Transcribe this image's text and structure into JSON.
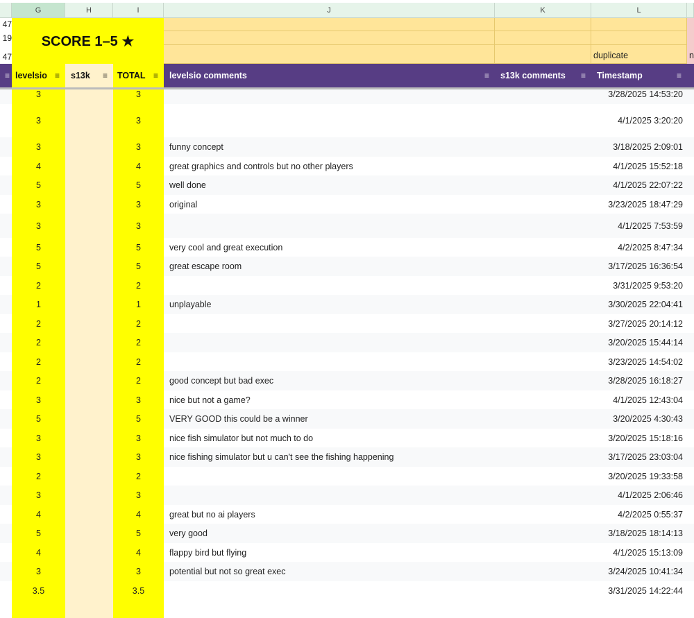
{
  "columns": [
    "G",
    "H",
    "I",
    "J",
    "K",
    "L"
  ],
  "row_numbers_partial": [
    "47",
    "19",
    "47"
  ],
  "banner": "SCORE 1–5 ★",
  "duplicate_label": "duplicate",
  "m_partial": "n",
  "headers": {
    "levelsio": "levelsio",
    "s13k": "s13k",
    "total": "TOTAL",
    "levelsio_comments": "levelsio comments",
    "s13k_comments": "s13k comments",
    "timestamp": "Timestamp"
  },
  "rows": [
    {
      "levelsio": "3",
      "total": "3",
      "comment": "",
      "timestamp": "3/28/2025 14:53:20"
    },
    {
      "levelsio": "3",
      "total": "3",
      "comment": "",
      "timestamp": "4/1/2025 3:20:20"
    },
    {
      "levelsio": "3",
      "total": "3",
      "comment": "funny concept",
      "timestamp": "3/18/2025 2:09:01"
    },
    {
      "levelsio": "4",
      "total": "4",
      "comment": "great graphics and controls but no other players",
      "timestamp": "4/1/2025 15:52:18"
    },
    {
      "levelsio": "5",
      "total": "5",
      "comment": "well done",
      "timestamp": "4/1/2025 22:07:22"
    },
    {
      "levelsio": "3",
      "total": "3",
      "comment": "original",
      "timestamp": "3/23/2025 18:47:29"
    },
    {
      "levelsio": "3",
      "total": "3",
      "comment": "",
      "timestamp": "4/1/2025 7:53:59"
    },
    {
      "levelsio": "5",
      "total": "5",
      "comment": "very cool and great execution",
      "timestamp": "4/2/2025 8:47:34"
    },
    {
      "levelsio": "5",
      "total": "5",
      "comment": "great escape room",
      "timestamp": "3/17/2025 16:36:54"
    },
    {
      "levelsio": "2",
      "total": "2",
      "comment": "",
      "timestamp": "3/31/2025 9:53:20"
    },
    {
      "levelsio": "1",
      "total": "1",
      "comment": "unplayable",
      "timestamp": "3/30/2025 22:04:41"
    },
    {
      "levelsio": "2",
      "total": "2",
      "comment": "",
      "timestamp": "3/27/2025 20:14:12"
    },
    {
      "levelsio": "2",
      "total": "2",
      "comment": "",
      "timestamp": "3/20/2025 15:44:14"
    },
    {
      "levelsio": "2",
      "total": "2",
      "comment": "",
      "timestamp": "3/23/2025 14:54:02"
    },
    {
      "levelsio": "2",
      "total": "2",
      "comment": "good concept but bad exec",
      "timestamp": "3/28/2025 16:18:27"
    },
    {
      "levelsio": "3",
      "total": "3",
      "comment": "nice but not a game?",
      "timestamp": "4/1/2025 12:43:04"
    },
    {
      "levelsio": "5",
      "total": "5",
      "comment": "VERY GOOD this could be a winner",
      "timestamp": "3/20/2025 4:30:43"
    },
    {
      "levelsio": "3",
      "total": "3",
      "comment": "nice fish simulator but not much to do",
      "timestamp": "3/20/2025 15:18:16"
    },
    {
      "levelsio": "3",
      "total": "3",
      "comment": "nice fishing simulator but u can't see the fishing happening",
      "timestamp": "3/17/2025 23:03:04"
    },
    {
      "levelsio": "2",
      "total": "2",
      "comment": "",
      "timestamp": "3/20/2025 19:33:58"
    },
    {
      "levelsio": "3",
      "total": "3",
      "comment": "",
      "timestamp": "4/1/2025 2:06:46"
    },
    {
      "levelsio": "4",
      "total": "4",
      "comment": "great but no ai players",
      "timestamp": "4/2/2025 0:55:37"
    },
    {
      "levelsio": "5",
      "total": "5",
      "comment": "very good",
      "timestamp": "3/18/2025 18:14:13"
    },
    {
      "levelsio": "4",
      "total": "4",
      "comment": "flappy bird but flying",
      "timestamp": "4/1/2025 15:13:09"
    },
    {
      "levelsio": "3",
      "total": "3",
      "comment": "potential but not so great exec",
      "timestamp": "3/24/2025 10:41:34"
    },
    {
      "levelsio": "3.5",
      "total": "3.5",
      "comment": "",
      "timestamp": "3/31/2025 14:22:44"
    }
  ]
}
